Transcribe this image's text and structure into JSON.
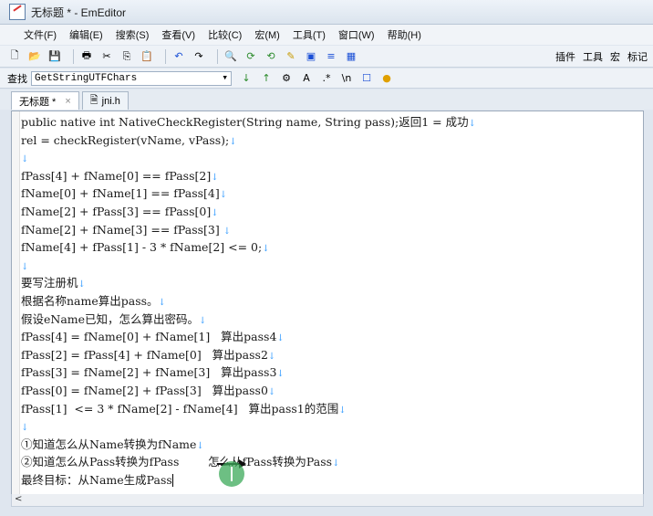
{
  "window": {
    "title": "无标题 * - EmEditor"
  },
  "menu": [
    "文件(F)",
    "编辑(E)",
    "搜索(S)",
    "查看(V)",
    "比较(C)",
    "宏(M)",
    "工具(T)",
    "窗口(W)",
    "帮助(H)"
  ],
  "toolbar": {
    "right_items": [
      "插件",
      "工具",
      "宏",
      "标记"
    ]
  },
  "find": {
    "label": "查找",
    "value": "GetStringUTFChars"
  },
  "tabs": [
    {
      "label": "无标题 *"
    },
    {
      "label": "jni.h"
    }
  ],
  "editor": {
    "lines": [
      "public native int NativeCheckRegister(String name, String pass);返回1 = 成功",
      "rel = checkRegister(vName, vPass);",
      "",
      "fPass[4] + fName[0] == fPass[2]",
      "fName[0] + fName[1] == fPass[4]",
      "fName[2] + fPass[3] == fPass[0]",
      "fName[2] + fName[3] == fPass[3] ",
      "fName[4] + fPass[1] - 3 * fName[2] <= 0;",
      "",
      "要写注册机",
      "根据名称name算出pass。",
      "假设eName已知，怎么算出密码。",
      "fPass[4] = fName[0] + fName[1]   算出pass4",
      "fPass[2] = fPass[4] + fName[0]   算出pass2",
      "fPass[3] = fName[2] + fName[3]   算出pass3",
      "fPass[0] = fName[2] + fPass[3]   算出pass0",
      "fPass[1]  <= 3 * fName[2] - fName[4]   算出pass1的范围",
      "",
      "①知道怎么从Name转换为fName",
      "②知道怎么从Pass转换为fPass        怎么从fPass转换为Pass",
      "最终目标：从Name生成Pass"
    ]
  },
  "scrollbar": {
    "left_arrow": "<"
  }
}
